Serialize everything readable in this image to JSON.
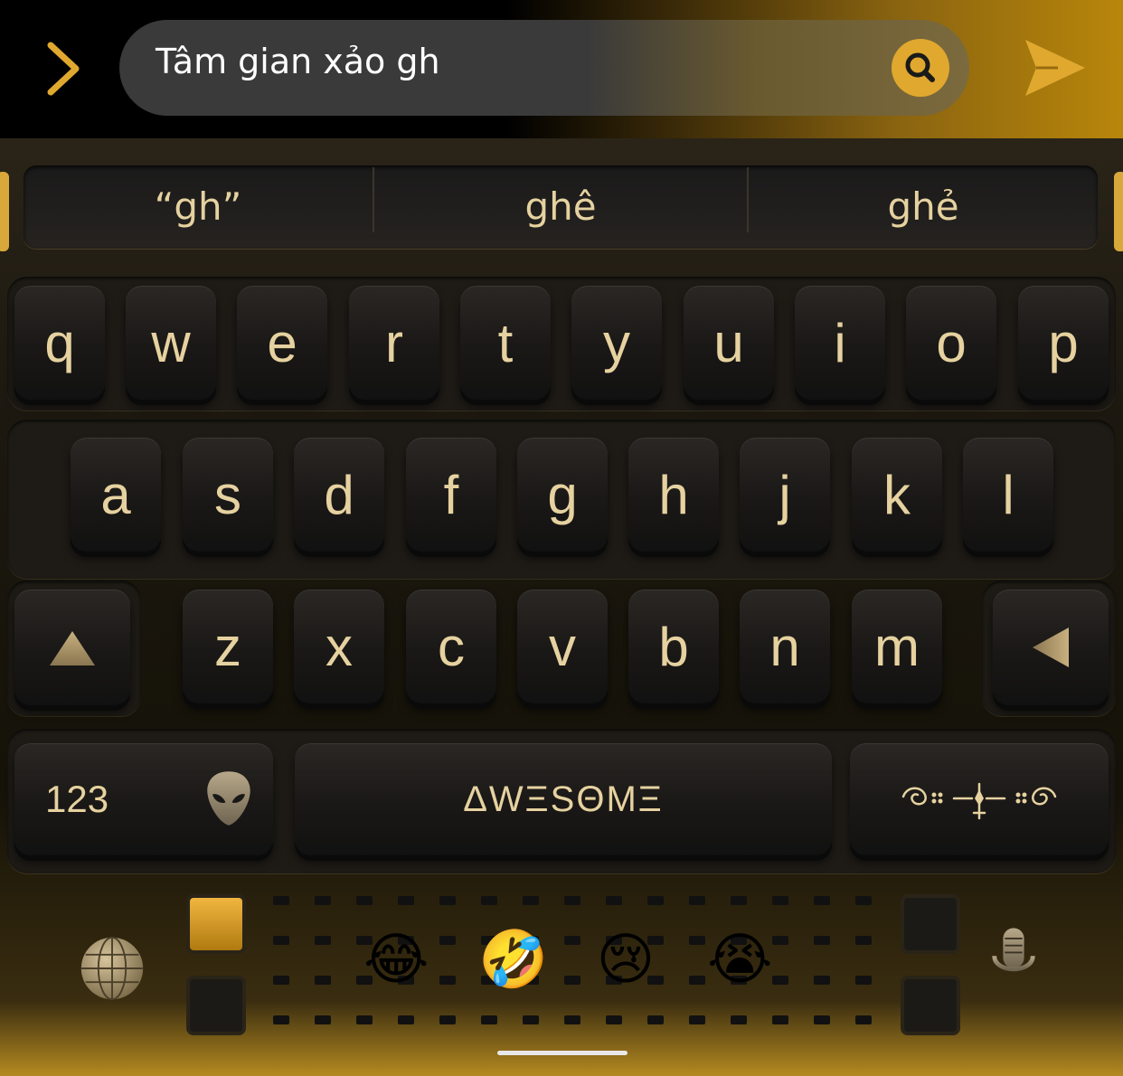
{
  "search": {
    "value": "Tâm gian xảo gh",
    "search_icon": "search-icon",
    "back_icon": "chevron-right-icon",
    "send_icon": "send-icon"
  },
  "suggestions": [
    "“gh”",
    "ghê",
    "ghẻ"
  ],
  "rows": {
    "row1": [
      "q",
      "w",
      "e",
      "r",
      "t",
      "y",
      "u",
      "i",
      "o",
      "p"
    ],
    "row2": [
      "a",
      "s",
      "d",
      "f",
      "g",
      "h",
      "j",
      "k",
      "l"
    ],
    "row3": [
      "z",
      "x",
      "c",
      "v",
      "b",
      "n",
      "m"
    ]
  },
  "keys": {
    "shift_icon": "shift-up-triangle-icon",
    "backspace_icon": "backspace-left-triangle-icon",
    "numbers_label": "123",
    "alien_icon": "alien-head-icon",
    "space_label": "ΔWΞSΘMΞ",
    "return_icon": "ornamental-flourish-icon"
  },
  "bottom": {
    "globe_icon": "globe-icon",
    "mic_icon": "microphone-icon",
    "emojis": [
      "😂",
      "🤣",
      "😢",
      "😭"
    ]
  },
  "colors": {
    "accent": "#e0a82e",
    "key_text": "#e6d2a0",
    "key_bg": "#1a1816"
  }
}
